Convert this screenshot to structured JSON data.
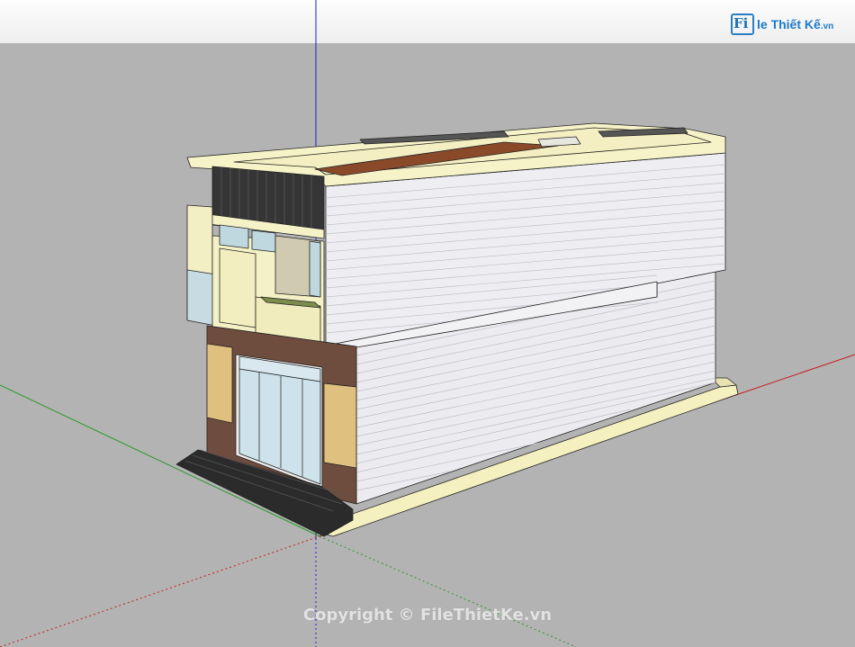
{
  "app": {
    "viewport_label": "3D model viewport"
  },
  "logo": {
    "mark": "Fi",
    "text": "le Thiết Kế",
    "suffix": ".vn"
  },
  "watermark": {
    "text": "Copyright © FileThietKe.vn"
  },
  "colors": {
    "ground": "#b3b3b3",
    "sky": "#f2f2f2",
    "axis_red": "#c81e1e",
    "axis_green": "#2a9a2a",
    "axis_blue": "#1f1fc8",
    "siding": "#e9e9ee",
    "trim": "#f6f2c8",
    "roof": "#8a4a2a",
    "brick": "#7a5545",
    "stone": "#e0c180",
    "glass": "#cfe3ea",
    "stairs": "#2c2c2c",
    "louver": "#333333",
    "logo_blue": "#1d7ac9"
  }
}
